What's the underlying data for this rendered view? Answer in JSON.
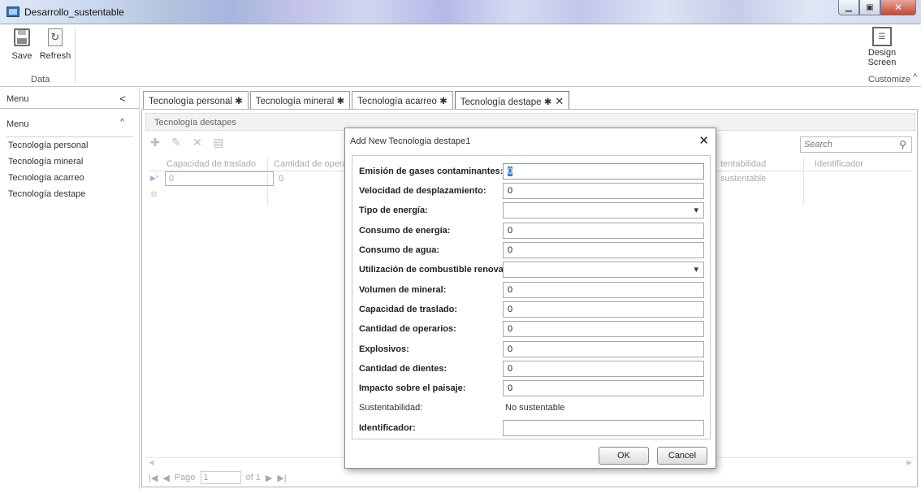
{
  "window": {
    "title": "Desarrollo_sustentable"
  },
  "ribbon": {
    "save_label": "Save",
    "refresh_label": "Refresh",
    "data_group": "Data",
    "design_label_1": "Design",
    "design_label_2": "Screen",
    "customize_group": "Customize",
    "collapse_glyph": "^"
  },
  "menu": {
    "header": "Menu",
    "collapse_glyph": "<",
    "group": "Menu",
    "group_glyph": "^",
    "items": [
      "Tecnología personal",
      "Tecnología mineral",
      "Tecnología acarreo",
      "Tecnología destape"
    ]
  },
  "tabs": [
    {
      "label": "Tecnología personal ✱"
    },
    {
      "label": "Tecnología mineral ✱"
    },
    {
      "label": "Tecnología acarreo ✱"
    },
    {
      "label": "Tecnología destape ✱"
    }
  ],
  "tab_close_glyph": "✕",
  "screen": {
    "title": "Tecnología destapes",
    "search_placeholder": "Search",
    "columns": [
      "Capacidad de traslado",
      "Cantidad de operari",
      "tentabilidad",
      "Identificador"
    ],
    "row": {
      "capacidad": "0",
      "cantidad": "0",
      "sustentabilidad": "sustentable"
    },
    "pager": {
      "page_label": "Page",
      "page_value": "1",
      "of_label": "of 1"
    }
  },
  "dialog": {
    "title": "Add New Tecnologia destape1",
    "fields": [
      {
        "label": "Emisión de gases contaminantes:",
        "value": "0"
      },
      {
        "label": "Velocidad de desplazamiento:",
        "value": "0"
      },
      {
        "label": "Tipo de energía:",
        "value": ""
      },
      {
        "label": "Consumo de energía:",
        "value": "0"
      },
      {
        "label": "Consumo de agua:",
        "value": "0"
      },
      {
        "label": "Utilización de combustible renovable:",
        "value": ""
      },
      {
        "label": "Volumen de mineral:",
        "value": "0"
      },
      {
        "label": "Capacidad de traslado:",
        "value": "0"
      },
      {
        "label": "Cantidad de operarios:",
        "value": "0"
      },
      {
        "label": "Explosivos:",
        "value": "0"
      },
      {
        "label": "Cantidad de dientes:",
        "value": "0"
      },
      {
        "label": "Impacto sobre el paisaje:",
        "value": "0"
      },
      {
        "label": "Sustentabilidad:",
        "value": "No sustentable"
      },
      {
        "label": "Identificador:",
        "value": ""
      }
    ],
    "ok_label": "OK",
    "cancel_label": "Cancel"
  }
}
